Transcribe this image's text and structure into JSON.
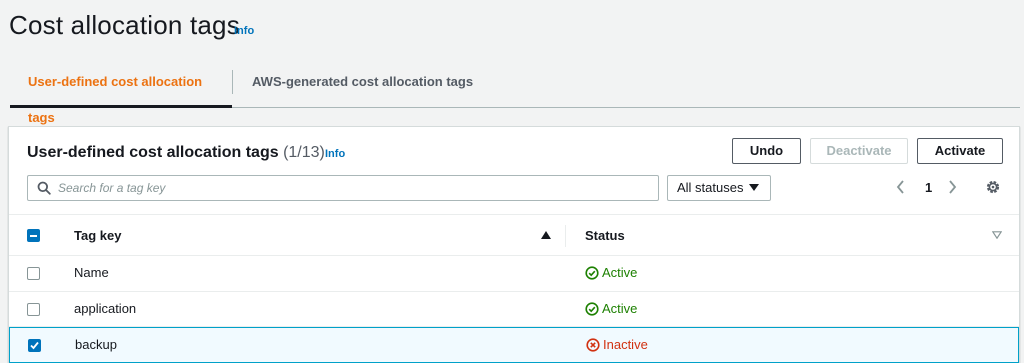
{
  "header": {
    "title": "Cost allocation tags",
    "info": "Info"
  },
  "tabs": [
    {
      "label": "User-defined cost allocation tags",
      "active": true
    },
    {
      "label": "AWS-generated cost allocation tags",
      "active": false
    }
  ],
  "panel": {
    "title": "User-defined cost allocation tags",
    "count": "(1/13)",
    "info": "Info",
    "buttons": {
      "undo": "Undo",
      "deactivate": "Deactivate",
      "activate": "Activate"
    },
    "search": {
      "placeholder": "Search for a tag key",
      "value": "",
      "icon": "search-icon"
    },
    "filter": {
      "selected": "All statuses",
      "icon": "caret-down-icon"
    },
    "pagination": {
      "current_page": "1"
    }
  },
  "table": {
    "columns": {
      "tag_key": "Tag key",
      "status": "Status"
    },
    "rows": [
      {
        "key": "Name",
        "status": "Active",
        "selected": false
      },
      {
        "key": "application",
        "status": "Active",
        "selected": false
      },
      {
        "key": "backup",
        "status": "Inactive",
        "selected": true
      }
    ]
  },
  "colors": {
    "accent": "#ec7211",
    "link": "#0073bb",
    "active": "#1d8102",
    "inactive": "#d13212"
  }
}
